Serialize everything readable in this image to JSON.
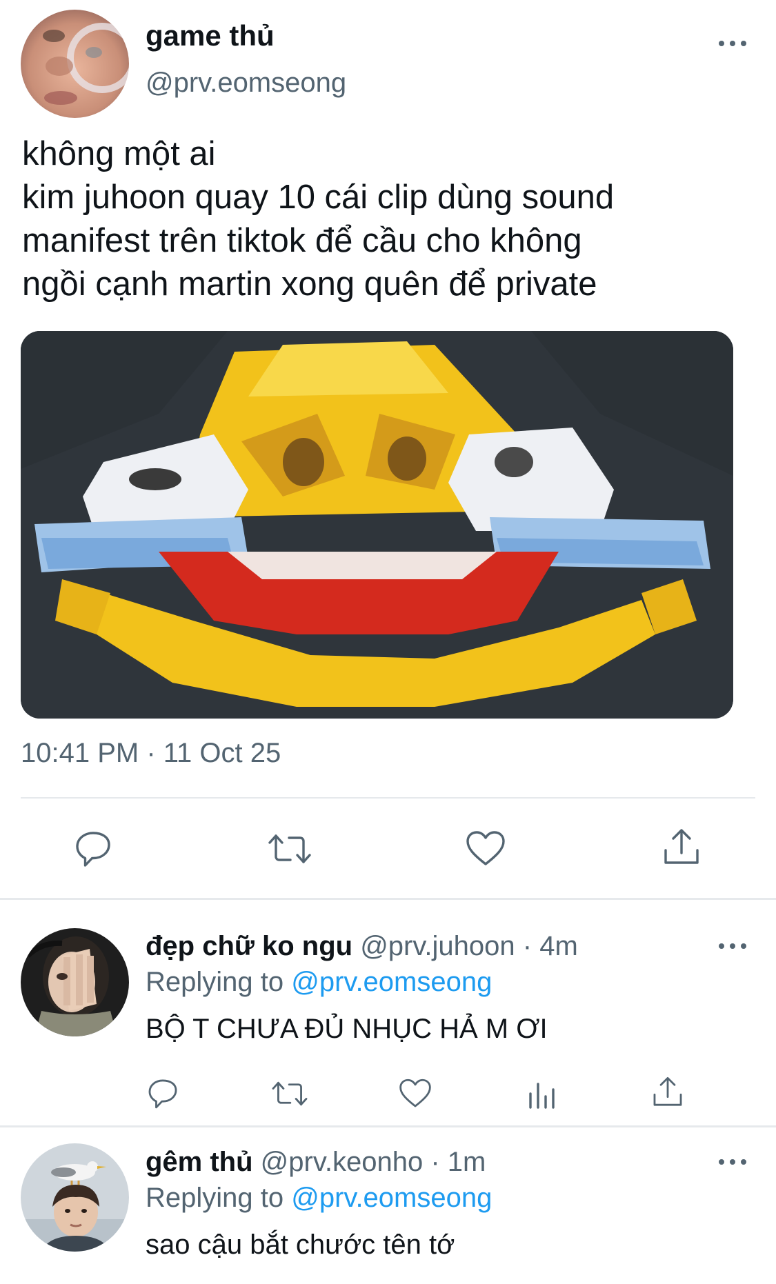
{
  "main_tweet": {
    "display_name": "game thủ",
    "handle": "@prv.eomseong",
    "text_lines": [
      "không một ai",
      "kim juhoon quay 10 cái clip dùng sound",
      "manifest trên tiktok để cầu cho không",
      "ngồi cạnh martin xong quên để private"
    ],
    "media_icon": "crying-laughing-emoji-image",
    "timestamp": "10:41 PM · 11 Oct 25",
    "actions": [
      "reply-icon",
      "retweet-icon",
      "like-icon",
      "share-icon"
    ]
  },
  "replies": [
    {
      "display_name": "đẹp chữ ko ngu",
      "handle": "@prv.juhoon",
      "time": "· 4m",
      "replying_prefix": "Replying to ",
      "replying_to": "@prv.eomseong",
      "text": "BỘ T CHƯA ĐỦ NHỤC HẢ M ƠI",
      "actions": [
        "reply-icon",
        "retweet-icon",
        "like-icon",
        "analytics-icon",
        "share-icon"
      ]
    },
    {
      "display_name": "gêm thủ",
      "handle": "@prv.keonho",
      "time": "· 1m",
      "replying_prefix": "Replying to ",
      "replying_to": "@prv.eomseong",
      "text": "sao cậu bắt chước tên tớ"
    }
  ],
  "colors": {
    "text": "#0f1419",
    "secondary": "#536471",
    "link": "#1d9bf0",
    "divider": "#e6e9ec"
  }
}
